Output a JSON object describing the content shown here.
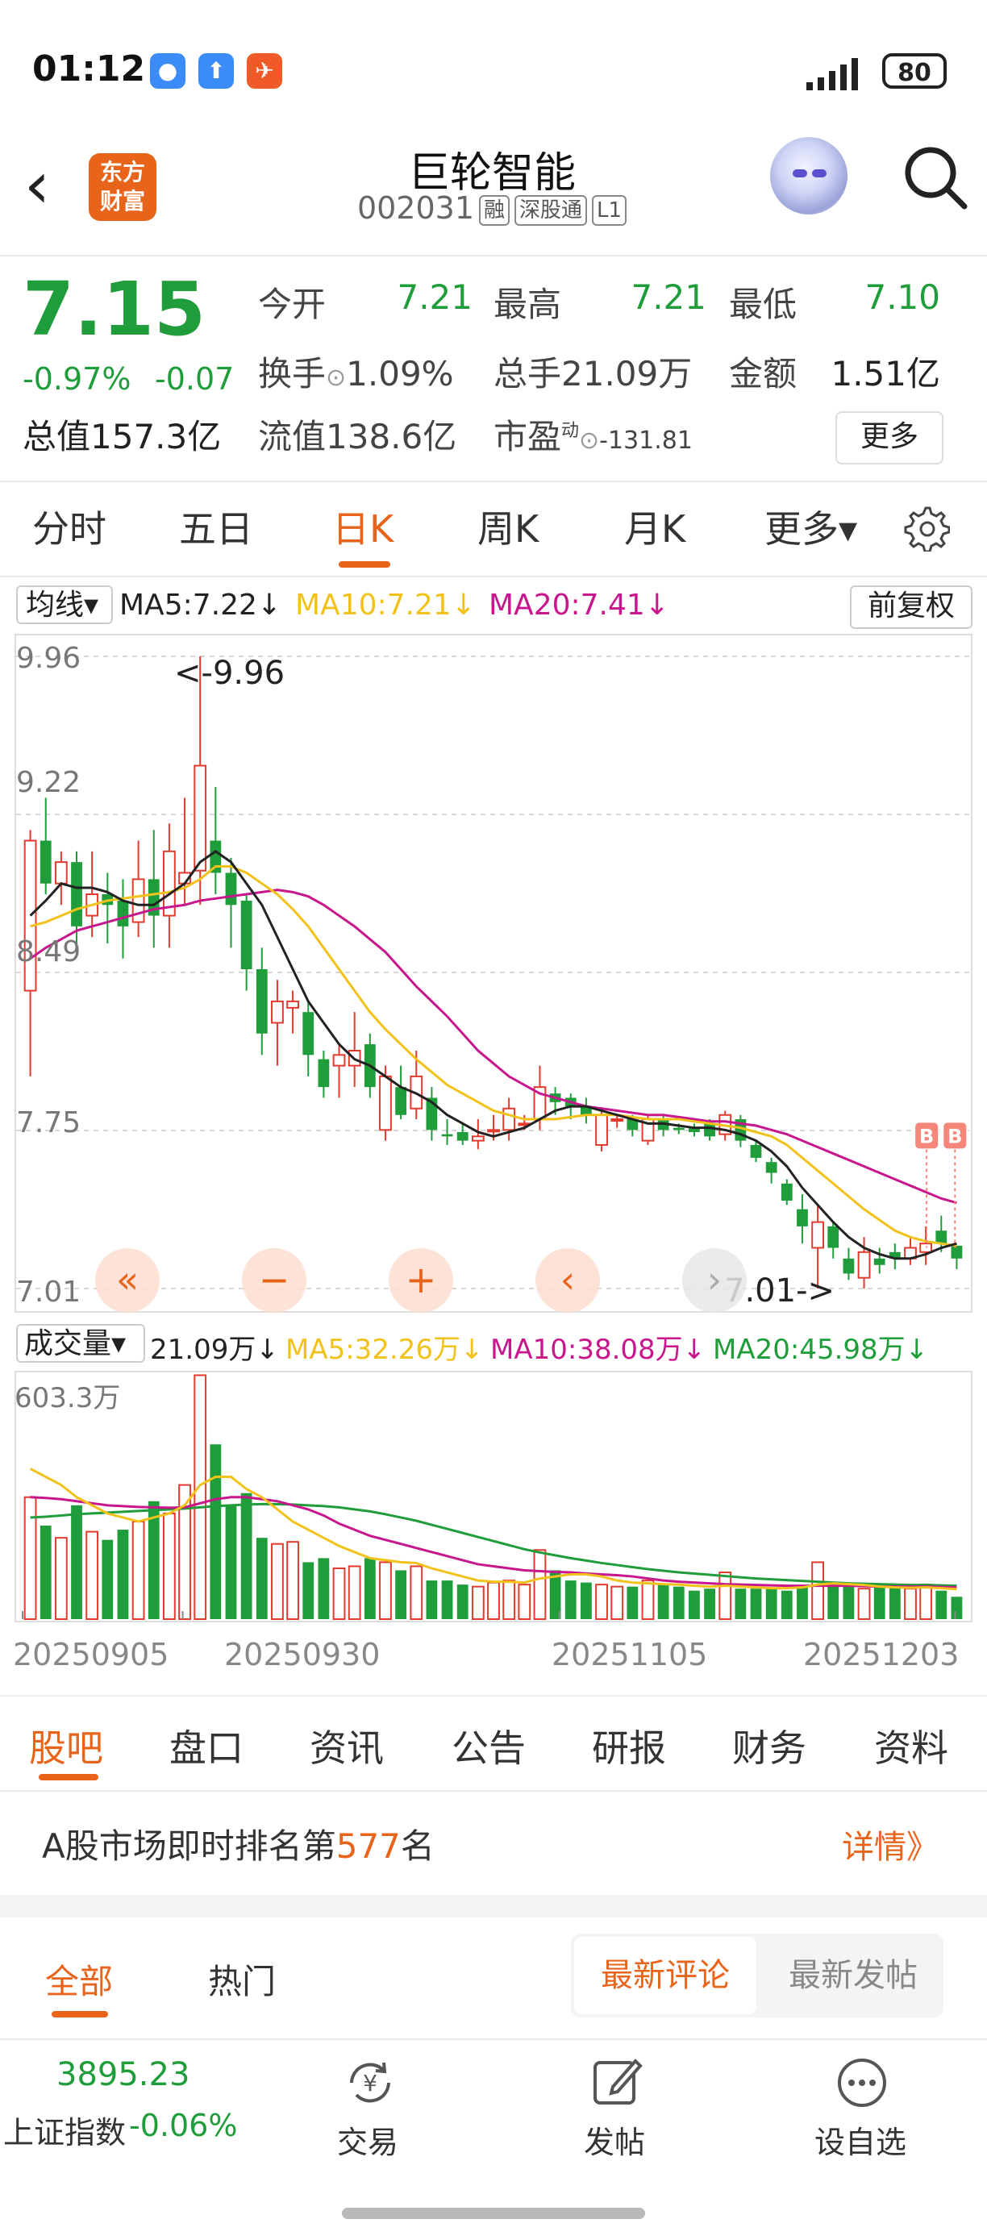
{
  "status_bar": {
    "time": "01:12",
    "battery": "80"
  },
  "header": {
    "logo_text": [
      "东方",
      "财富"
    ],
    "stock_name": "巨轮智能",
    "stock_code": "002031",
    "tags": [
      "融",
      "深股通",
      "L1"
    ]
  },
  "quote": {
    "price": "7.15",
    "change_pct": "-0.97%",
    "change": "-0.07",
    "market_cap_label": "总值",
    "market_cap": "157.3亿",
    "open_label": "今开",
    "open": "7.21",
    "high_label": "最高",
    "high": "7.21",
    "low_label": "最低",
    "low": "7.10",
    "turnover_label": "换手",
    "turnover": "1.09%",
    "volume_label": "总手",
    "volume": "21.09万",
    "amount_label": "金额",
    "amount": "1.51亿",
    "float_cap_label": "流值",
    "float_cap": "138.6亿",
    "pe_label": "市盈",
    "pe_sup": "动",
    "pe": "-131.81",
    "more_label": "更多"
  },
  "period_tabs": [
    "分时",
    "五日",
    "日K",
    "周K",
    "月K",
    "更多▾"
  ],
  "ma_bar": {
    "select": "均线▾",
    "ma5": "MA5:7.22↓",
    "ma10": "MA10:7.21↓",
    "ma20": "MA20:7.41↓",
    "adjust": "前复权"
  },
  "chart_data": {
    "type": "candlestick",
    "y_ticks": [
      "9.96",
      "9.22",
      "8.49",
      "7.75",
      "7.01"
    ],
    "ylim": [
      7.01,
      9.96
    ],
    "max_label": "<-9.96",
    "min_label": "7.01->",
    "x_labels": [
      "20250905",
      "20250930",
      "20251105",
      "20251203"
    ],
    "candles": [
      [
        8.4,
        9.1,
        8.0,
        9.15
      ],
      [
        9.1,
        8.9,
        8.85,
        9.3
      ],
      [
        8.9,
        9.0,
        8.8,
        9.05
      ],
      [
        9.0,
        8.7,
        8.6,
        9.05
      ],
      [
        8.75,
        8.85,
        8.65,
        9.05
      ],
      [
        8.85,
        8.8,
        8.62,
        8.95
      ],
      [
        8.82,
        8.7,
        8.55,
        8.92
      ],
      [
        8.72,
        8.92,
        8.65,
        9.1
      ],
      [
        8.92,
        8.75,
        8.6,
        9.15
      ],
      [
        8.75,
        9.05,
        8.6,
        9.18
      ],
      [
        8.9,
        8.95,
        8.8,
        9.3
      ],
      [
        8.96,
        9.45,
        8.8,
        9.96
      ],
      [
        9.1,
        8.95,
        8.85,
        9.35
      ],
      [
        8.95,
        8.8,
        8.6,
        9.02
      ],
      [
        8.82,
        8.5,
        8.4,
        8.85
      ],
      [
        8.5,
        8.2,
        8.1,
        8.6
      ],
      [
        8.25,
        8.35,
        8.05,
        8.45
      ],
      [
        8.32,
        8.35,
        8.2,
        8.4
      ],
      [
        8.3,
        8.1,
        8.0,
        8.35
      ],
      [
        8.08,
        7.95,
        7.9,
        8.12
      ],
      [
        8.05,
        8.1,
        7.9,
        8.15
      ],
      [
        8.05,
        8.12,
        7.95,
        8.3
      ],
      [
        8.15,
        7.95,
        7.9,
        8.2
      ],
      [
        7.75,
        8.0,
        7.7,
        8.05
      ],
      [
        7.95,
        7.82,
        7.8,
        8.05
      ],
      [
        7.85,
        8.0,
        7.8,
        8.12
      ],
      [
        7.9,
        7.75,
        7.7,
        7.95
      ],
      [
        7.73,
        7.72,
        7.68,
        7.8
      ],
      [
        7.74,
        7.7,
        7.68,
        7.78
      ],
      [
        7.7,
        7.72,
        7.66,
        7.8
      ],
      [
        7.75,
        7.75,
        7.7,
        7.82
      ],
      [
        7.75,
        7.85,
        7.7,
        7.9
      ],
      [
        7.78,
        7.78,
        7.75,
        7.82
      ],
      [
        7.8,
        7.95,
        7.75,
        8.05
      ],
      [
        7.92,
        7.88,
        7.82,
        7.95
      ],
      [
        7.9,
        7.86,
        7.8,
        7.92
      ],
      [
        7.86,
        7.82,
        7.78,
        7.9
      ],
      [
        7.68,
        7.82,
        7.65,
        7.85
      ],
      [
        7.8,
        7.8,
        7.76,
        7.82
      ],
      [
        7.8,
        7.75,
        7.72,
        7.82
      ],
      [
        7.7,
        7.8,
        7.68,
        7.82
      ],
      [
        7.8,
        7.75,
        7.72,
        7.82
      ],
      [
        7.76,
        7.75,
        7.73,
        7.78
      ],
      [
        7.76,
        7.74,
        7.72,
        7.78
      ],
      [
        7.78,
        7.72,
        7.7,
        7.8
      ],
      [
        7.73,
        7.82,
        7.7,
        7.84
      ],
      [
        7.8,
        7.7,
        7.67,
        7.82
      ],
      [
        7.68,
        7.62,
        7.6,
        7.7
      ],
      [
        7.6,
        7.55,
        7.5,
        7.62
      ],
      [
        7.5,
        7.42,
        7.4,
        7.52
      ],
      [
        7.38,
        7.3,
        7.22,
        7.45
      ],
      [
        7.2,
        7.32,
        7.01,
        7.4
      ],
      [
        7.3,
        7.2,
        7.15,
        7.32
      ],
      [
        7.15,
        7.08,
        7.05,
        7.2
      ],
      [
        7.06,
        7.18,
        7.01,
        7.25
      ],
      [
        7.15,
        7.12,
        7.08,
        7.2
      ],
      [
        7.18,
        7.15,
        7.1,
        7.22
      ],
      [
        7.15,
        7.2,
        7.12,
        7.25
      ],
      [
        7.18,
        7.22,
        7.12,
        7.3
      ],
      [
        7.28,
        7.22,
        7.18,
        7.35
      ],
      [
        7.21,
        7.15,
        7.1,
        7.21
      ]
    ],
    "ma5": [
      8.75,
      8.82,
      8.9,
      8.88,
      8.88,
      8.86,
      8.82,
      8.8,
      8.8,
      8.85,
      8.9,
      9.0,
      9.05,
      9.0,
      8.9,
      8.8,
      8.65,
      8.5,
      8.35,
      8.25,
      8.15,
      8.08,
      8.05,
      8.0,
      7.95,
      7.92,
      7.88,
      7.82,
      7.78,
      7.74,
      7.72,
      7.74,
      7.76,
      7.8,
      7.84,
      7.86,
      7.86,
      7.84,
      7.82,
      7.8,
      7.78,
      7.78,
      7.77,
      7.76,
      7.76,
      7.75,
      7.73,
      7.7,
      7.65,
      7.58,
      7.48,
      7.4,
      7.32,
      7.25,
      7.2,
      7.17,
      7.15,
      7.15,
      7.17,
      7.2,
      7.22
    ],
    "ma10": [
      8.7,
      8.72,
      8.75,
      8.78,
      8.8,
      8.82,
      8.83,
      8.84,
      8.85,
      8.86,
      8.88,
      8.92,
      8.98,
      8.98,
      8.95,
      8.9,
      8.85,
      8.78,
      8.7,
      8.6,
      8.5,
      8.4,
      8.3,
      8.22,
      8.15,
      8.08,
      8.02,
      7.96,
      7.92,
      7.88,
      7.84,
      7.82,
      7.8,
      7.8,
      7.8,
      7.81,
      7.82,
      7.82,
      7.82,
      7.81,
      7.8,
      7.8,
      7.8,
      7.79,
      7.78,
      7.77,
      7.76,
      7.74,
      7.72,
      7.68,
      7.62,
      7.56,
      7.5,
      7.44,
      7.38,
      7.33,
      7.28,
      7.25,
      7.23,
      7.22,
      7.21
    ],
    "ma20": [
      8.55,
      8.6,
      8.64,
      8.68,
      8.7,
      8.72,
      8.74,
      8.76,
      8.78,
      8.79,
      8.8,
      8.82,
      8.83,
      8.84,
      8.85,
      8.86,
      8.87,
      8.86,
      8.84,
      8.8,
      8.75,
      8.7,
      8.64,
      8.58,
      8.5,
      8.42,
      8.35,
      8.28,
      8.2,
      8.12,
      8.06,
      8.0,
      7.96,
      7.92,
      7.9,
      7.88,
      7.86,
      7.85,
      7.84,
      7.83,
      7.82,
      7.82,
      7.81,
      7.8,
      7.79,
      7.79,
      7.78,
      7.77,
      7.75,
      7.73,
      7.7,
      7.67,
      7.64,
      7.61,
      7.58,
      7.55,
      7.52,
      7.49,
      7.46,
      7.43,
      7.41
    ]
  },
  "chart_controls": [
    "«",
    "−",
    "+",
    "‹",
    "›"
  ],
  "volume_bar": {
    "select": "成交量▾",
    "current": "21.09万↓",
    "ma5": "MA5:32.26万↓",
    "ma10": "MA10:38.08万↓",
    "ma20": "MA20:45.98万↓",
    "max_label": "603.3万",
    "volumes": [
      300,
      230,
      200,
      280,
      215,
      195,
      220,
      240,
      290,
      260,
      330,
      600,
      430,
      280,
      310,
      200,
      185,
      190,
      140,
      150,
      125,
      130,
      150,
      140,
      120,
      130,
      95,
      95,
      85,
      80,
      90,
      95,
      85,
      170,
      120,
      95,
      90,
      85,
      80,
      80,
      95,
      85,
      80,
      70,
      75,
      115,
      75,
      75,
      75,
      70,
      80,
      140,
      90,
      80,
      75,
      80,
      80,
      75,
      85,
      70,
      55
    ],
    "vma5": [
      370,
      350,
      330,
      300,
      280,
      260,
      250,
      240,
      250,
      260,
      280,
      330,
      350,
      350,
      320,
      300,
      270,
      240,
      220,
      200,
      180,
      165,
      150,
      145,
      140,
      138,
      125,
      115,
      105,
      95,
      92,
      92,
      90,
      100,
      105,
      110,
      110,
      105,
      95,
      90,
      88,
      86,
      85,
      82,
      80,
      82,
      80,
      78,
      76,
      76,
      78,
      85,
      88,
      86,
      84,
      80,
      78,
      77,
      78,
      76,
      74
    ],
    "vma10": [
      300,
      298,
      295,
      290,
      285,
      280,
      278,
      276,
      275,
      274,
      275,
      285,
      295,
      300,
      300,
      295,
      290,
      280,
      270,
      255,
      235,
      220,
      205,
      195,
      185,
      175,
      165,
      155,
      145,
      135,
      130,
      125,
      120,
      118,
      116,
      115,
      112,
      110,
      108,
      105,
      100,
      95,
      92,
      90,
      88,
      86,
      85,
      84,
      83,
      82,
      82,
      82,
      82,
      82,
      81,
      80,
      80,
      80,
      80,
      79,
      78
    ],
    "vma20": [
      250,
      252,
      255,
      258,
      260,
      262,
      264,
      266,
      268,
      270,
      272,
      275,
      278,
      280,
      282,
      283,
      283,
      282,
      280,
      278,
      275,
      270,
      265,
      258,
      250,
      242,
      232,
      222,
      212,
      202,
      192,
      182,
      172,
      164,
      157,
      150,
      144,
      138,
      133,
      128,
      123,
      119,
      115,
      112,
      109,
      106,
      103,
      100,
      98,
      96,
      94,
      92,
      90,
      88,
      87,
      86,
      85,
      84,
      84,
      83,
      82
    ]
  },
  "section_tabs": [
    "股吧",
    "盘口",
    "资讯",
    "公告",
    "研报",
    "财务",
    "资料"
  ],
  "rank": {
    "prefix": "A股市场即时排名第",
    "number": "577",
    "suffix": "名",
    "detail": "详情》"
  },
  "feed_tabs": [
    "全部",
    "热门"
  ],
  "sort_options": [
    "最新评论",
    "最新发帖"
  ],
  "bottom_bar": {
    "index_value": "3895.23",
    "index_name": "上证指数",
    "index_change": "-0.06%",
    "trade_label": "交易",
    "post_label": "发帖",
    "watch_label": "设自选"
  },
  "colors": {
    "up": "#e23b2e",
    "down": "#1f9d3a",
    "accent": "#e8641b",
    "ma5": "#222222",
    "ma10": "#f2c21a",
    "ma20": "#c8168d"
  }
}
